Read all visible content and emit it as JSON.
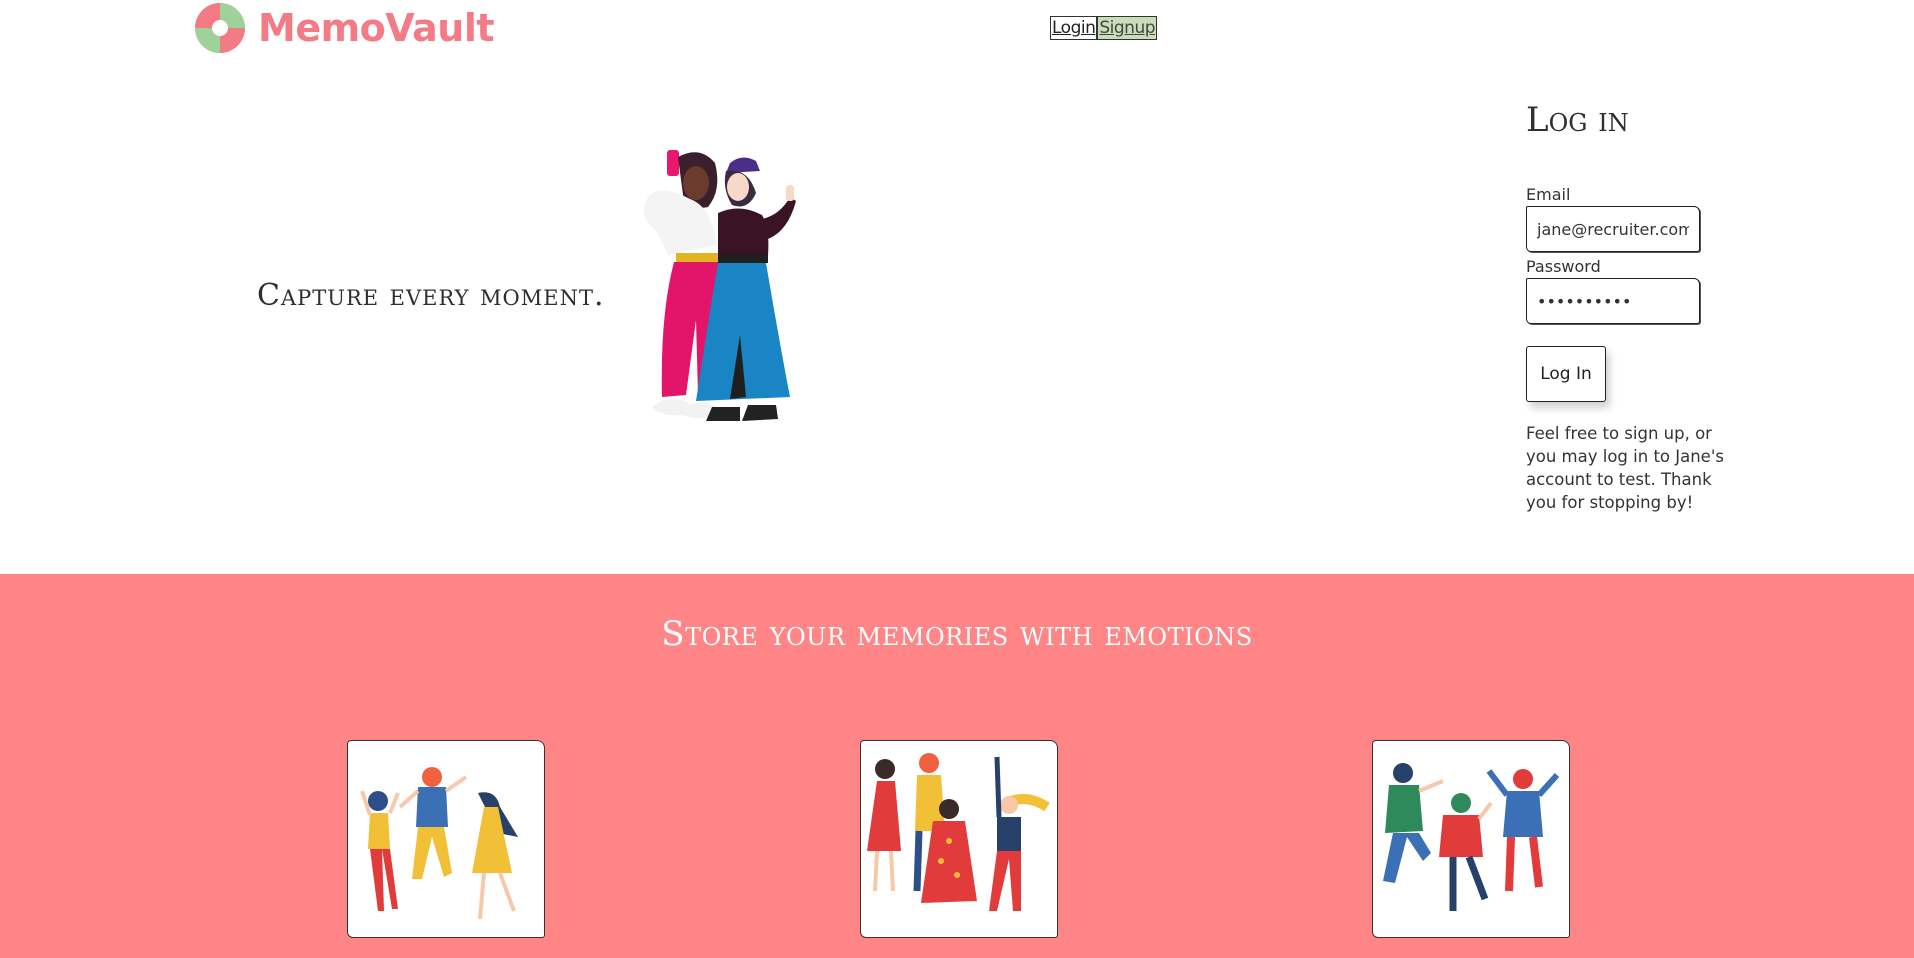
{
  "header": {
    "brand_name": "MemoVault",
    "logo_icon": "camera-aperture-logo",
    "nav": {
      "login_label": "Login",
      "signup_label": "Signup"
    }
  },
  "hero": {
    "tagline": "Capture every moment."
  },
  "login": {
    "title": "Log in",
    "email_label": "Email",
    "email_value": "jane@recruiter.com",
    "password_label": "Password",
    "password_value": "••••••••••",
    "submit_label": "Log In",
    "note": "Feel free to sign up, or you may log in to Jane's account to test. Thank you for stopping by!"
  },
  "features": {
    "title": "Store your memories with emotions"
  },
  "colors": {
    "brand": "#f37b86",
    "band": "#ff8587",
    "signup_bg": "#c9ddb8"
  }
}
